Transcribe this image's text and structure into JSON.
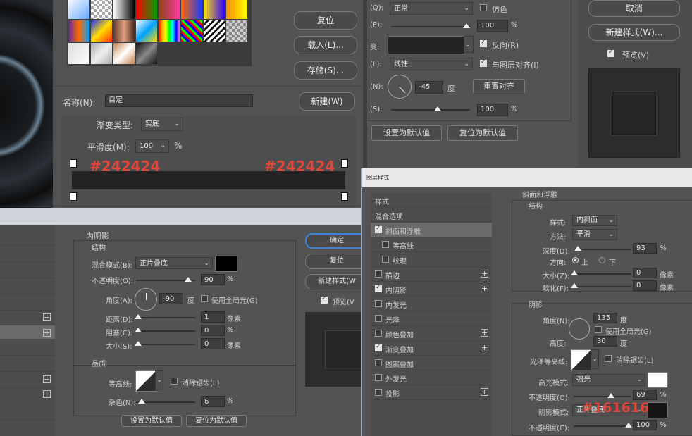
{
  "gradient_editor": {
    "reset_button": "复位",
    "load_button": "载入(L)...",
    "save_button": "存储(S)...",
    "name_label": "名称(N):",
    "name_value": "自定",
    "new_button": "新建(W)",
    "gradient_type_label": "渐变类型:",
    "gradient_type_value": "实底",
    "smoothness_label": "平滑度(M):",
    "smoothness_value": "100",
    "smoothness_unit": "%",
    "left_color_note": "#242424",
    "right_color_note": "#242424",
    "bar_color": "#242424"
  },
  "gradient_overlay": {
    "blend_label": "(Q):",
    "blend_value": "正常",
    "dither_label": "仿色",
    "opacity_label": "(P):",
    "opacity_value": "100",
    "gradient_label": "变:",
    "reverse_label": "反向(R)",
    "style_label": "(L):",
    "style_value": "线性",
    "align_label": "与图层对齐(I)",
    "angle_label": "(N):",
    "angle_value": "-45",
    "angle_unit": "度",
    "reset_align_button": "重置对齐",
    "scale_label": "(S):",
    "scale_value": "100",
    "scale_unit": "%",
    "set_default_button": "设置为默认值",
    "reset_default_button": "复位为默认值",
    "cancel_button": "取消",
    "new_style_button": "新建样式(W)...",
    "preview_label": "预览(V)"
  },
  "inner_shadow": {
    "section_title": "内阴影",
    "structure_title": "结构",
    "blend_label": "混合模式(B):",
    "blend_value": "正片叠底",
    "opacity_label": "不透明度(O):",
    "opacity_value": "90",
    "opacity_unit": "%",
    "angle_label": "角度(A):",
    "angle_value": "-90",
    "angle_unit": "度",
    "global_light_label": "使用全局光(G)",
    "distance_label": "距离(D):",
    "distance_value": "1",
    "px_unit": "像素",
    "choke_label": "阻塞(C):",
    "choke_value": "0",
    "choke_unit": "%",
    "size_label": "大小(S):",
    "size_value": "0",
    "quality_title": "品质",
    "contour_label": "等高线:",
    "antialias_label": "消除锯齿(L)",
    "noise_label": "杂色(N):",
    "noise_value": "6",
    "noise_unit": "%",
    "set_default_button": "设置为默认值",
    "reset_default_button": "复位为默认值",
    "ok_button": "确定",
    "reset_button": "复位",
    "new_style_button": "新建样式(W",
    "preview_label": "预览(V"
  },
  "layer_style": {
    "window_title": "图层样式",
    "list": [
      {
        "label": "样式",
        "checkbox": false,
        "checked": false,
        "plus": false,
        "selected": false
      },
      {
        "label": "混合选项",
        "checkbox": false,
        "checked": false,
        "plus": false,
        "selected": false
      },
      {
        "label": "斜面和浮雕",
        "checkbox": true,
        "checked": true,
        "plus": false,
        "selected": true
      },
      {
        "label": "等高线",
        "checkbox": true,
        "checked": false,
        "plus": false,
        "selected": false
      },
      {
        "label": "纹理",
        "checkbox": true,
        "checked": false,
        "plus": false,
        "selected": false
      },
      {
        "label": "描边",
        "checkbox": true,
        "checked": false,
        "plus": true,
        "selected": false
      },
      {
        "label": "内阴影",
        "checkbox": true,
        "checked": true,
        "plus": true,
        "selected": false
      },
      {
        "label": "内发光",
        "checkbox": true,
        "checked": false,
        "plus": false,
        "selected": false
      },
      {
        "label": "光泽",
        "checkbox": true,
        "checked": false,
        "plus": false,
        "selected": false
      },
      {
        "label": "颜色叠加",
        "checkbox": true,
        "checked": false,
        "plus": true,
        "selected": false
      },
      {
        "label": "渐变叠加",
        "checkbox": true,
        "checked": true,
        "plus": true,
        "selected": false
      },
      {
        "label": "图案叠加",
        "checkbox": true,
        "checked": false,
        "plus": false,
        "selected": false
      },
      {
        "label": "外发光",
        "checkbox": true,
        "checked": false,
        "plus": false,
        "selected": false
      },
      {
        "label": "投影",
        "checkbox": true,
        "checked": false,
        "plus": true,
        "selected": false
      }
    ],
    "bevel_title": "斜面和浮雕",
    "structure_title": "结构",
    "style_label": "样式:",
    "style_value": "内斜面",
    "technique_label": "方法:",
    "technique_value": "平滑",
    "depth_label": "深度(D):",
    "depth_value": "93",
    "depth_unit": "%",
    "direction_label": "方向:",
    "direction_up": "上",
    "direction_down": "下",
    "size_label": "大小(Z):",
    "size_value": "0",
    "px_unit": "像素",
    "soften_label": "软化(F):",
    "soften_value": "0",
    "shading_title": "阴影",
    "angle_label": "角度(N):",
    "angle_value": "135",
    "angle_unit": "度",
    "global_light_label": "使用全局光(G)",
    "altitude_label": "高度:",
    "altitude_value": "30",
    "gloss_label": "光泽等高线:",
    "antialias_label": "消除锯齿(L)",
    "highlight_label": "高光模式:",
    "highlight_value": "强光",
    "hl_opacity_label": "不透明度(O):",
    "hl_opacity_value": "69",
    "shadow_mode_label": "阴影模式:",
    "shadow_mode_value": "正片叠底",
    "shadow_color_note": "#161616",
    "sh_opacity_label": "不透明度(C):",
    "sh_opacity_value": "100",
    "percent": "%"
  },
  "colors": {
    "highlight_swatch": "#ffffff",
    "shadow_swatch": "#161616",
    "inner_shadow_swatch": "#000000",
    "annotation_red": "#e0453a"
  }
}
